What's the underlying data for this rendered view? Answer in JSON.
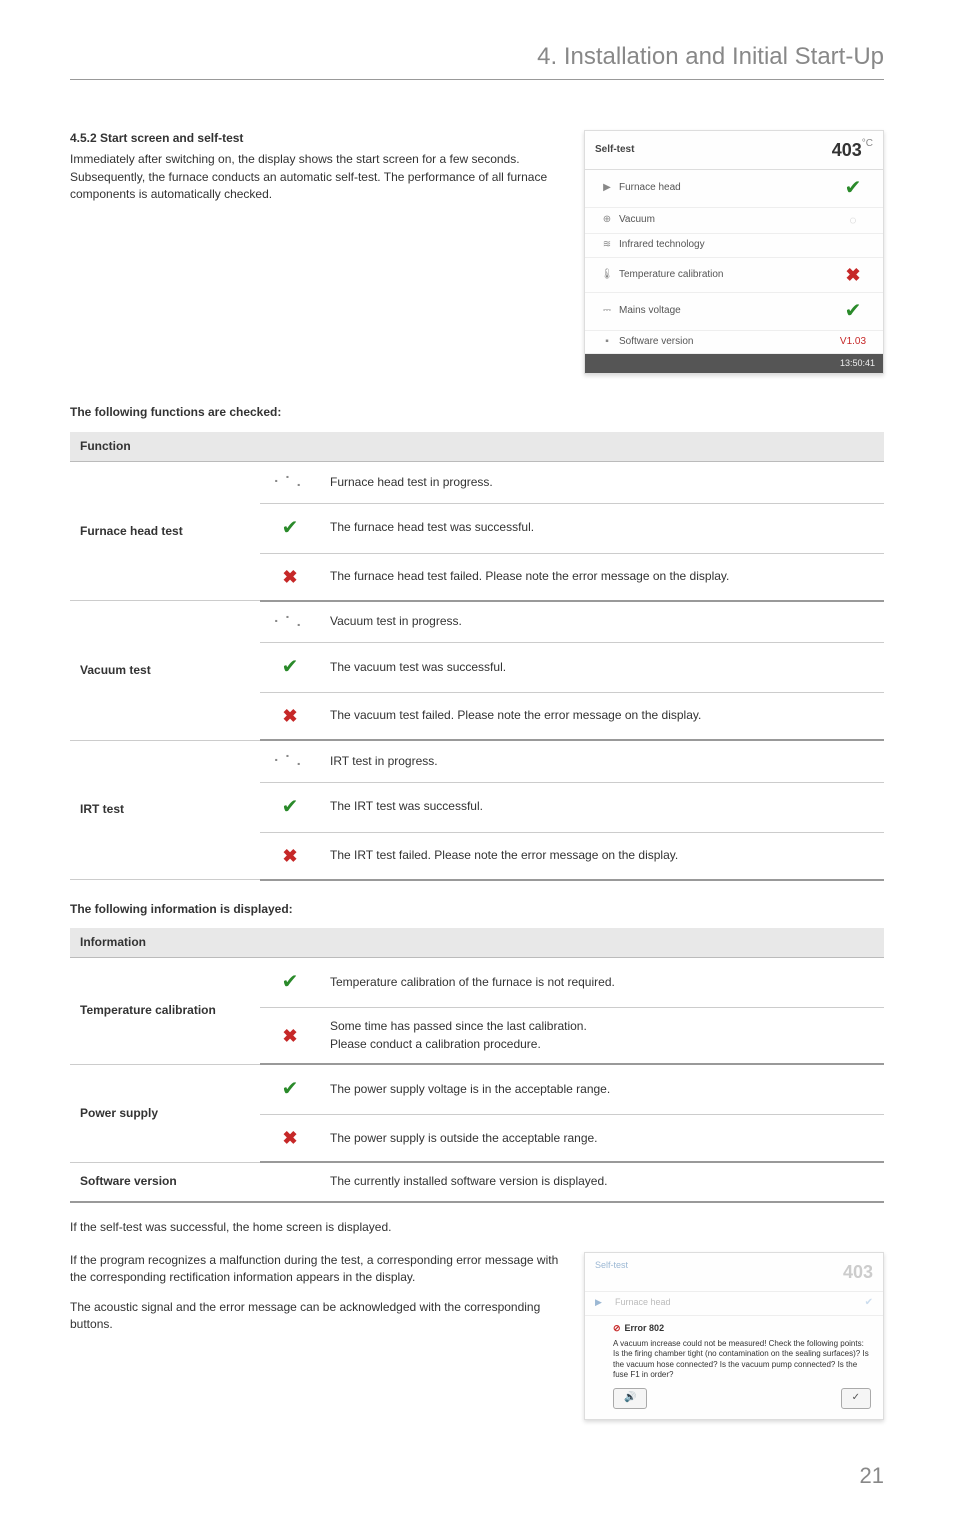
{
  "header": {
    "title": "4. Installation and Initial Start-Up"
  },
  "section": {
    "heading": "4.5.2  Start screen and self-test",
    "body": "Immediately after switching on, the display shows the start screen for a few seconds. Subsequently, the furnace conducts an automatic self-test. The performance of all furnace components is automatically checked."
  },
  "selftest_screenshot": {
    "title": "Self-test",
    "temperature": "403",
    "temperature_unit": "°C",
    "rows": [
      {
        "icon": "flame-icon",
        "icon_char": "▶",
        "label": "Furnace head",
        "status_icon": "check",
        "status_char": "✔"
      },
      {
        "icon": "gauge-icon",
        "icon_char": "⊕",
        "label": "Vacuum",
        "status_icon": "spinner",
        "status_char": "◌"
      },
      {
        "icon": "waves-icon",
        "icon_char": "≋",
        "label": "Infrared technology",
        "status_icon": "",
        "status_char": ""
      },
      {
        "icon": "thermometer-icon",
        "icon_char": "🌡",
        "label": "Temperature calibration",
        "status_icon": "x",
        "status_char": "✖"
      },
      {
        "icon": "plug-icon",
        "icon_char": "⎓",
        "label": "Mains voltage",
        "status_icon": "check",
        "status_char": "✔"
      },
      {
        "icon": "chip-icon",
        "icon_char": "▪",
        "label": "Software version",
        "status_icon": "version",
        "status_char": "V1.03"
      }
    ],
    "footer_time": "13:50:41"
  },
  "functions_heading": "The following functions are checked:",
  "functions_table": {
    "header": "Function",
    "groups": [
      {
        "label": "Furnace head test",
        "rows": [
          {
            "icon": "progress",
            "desc": "Furnace head test in progress."
          },
          {
            "icon": "check",
            "desc": "The furnace head test was successful."
          },
          {
            "icon": "x",
            "desc": "The furnace head test failed. Please note the error message on the display."
          }
        ]
      },
      {
        "label": "Vacuum test",
        "rows": [
          {
            "icon": "progress",
            "desc": "Vacuum test in progress."
          },
          {
            "icon": "check",
            "desc": "The vacuum test was successful."
          },
          {
            "icon": "x",
            "desc": "The vacuum test failed. Please note the error message on the display."
          }
        ]
      },
      {
        "label": "IRT test",
        "rows": [
          {
            "icon": "progress",
            "desc": "IRT test in progress."
          },
          {
            "icon": "check",
            "desc": "The IRT test was successful."
          },
          {
            "icon": "x",
            "desc": "The IRT test failed. Please note the error message on the display."
          }
        ]
      }
    ]
  },
  "info_heading": "The following information is displayed:",
  "info_table": {
    "header": "Information",
    "groups": [
      {
        "label": "Temperature calibration",
        "rows": [
          {
            "icon": "check",
            "desc": "Temperature calibration of the furnace is not required."
          },
          {
            "icon": "x",
            "desc": "Some time has passed since the last calibration.\nPlease conduct a calibration procedure."
          }
        ]
      },
      {
        "label": "Power supply",
        "rows": [
          {
            "icon": "check",
            "desc": "The power supply voltage is in the acceptable range."
          },
          {
            "icon": "x",
            "desc": "The power supply is outside the acceptable range."
          }
        ]
      },
      {
        "label": "Software version",
        "rows": [
          {
            "icon": "",
            "desc": "The currently installed software version is displayed."
          }
        ]
      }
    ]
  },
  "bottom": {
    "p1": "If the self-test was successful, the home screen is displayed.",
    "p2": "If the program recognizes a malfunction during the test, a corresponding error message with the corresponding rectification information appears in the display.",
    "p3": "The acoustic signal and the error message can be acknowledged with the corresponding buttons."
  },
  "error_screenshot": {
    "title": "Self-test",
    "temperature": "403",
    "row1_label": "Furnace head",
    "error_title": "Error 802",
    "error_msg": "A vacuum increase could not be measured! Check the following points: Is the firing chamber tight (no contamination on the sealing surfaces)? Is the vacuum hose connected? Is the vacuum pump connected? Is the fuse F1 in order?",
    "btn_sound": "🔊",
    "btn_ok": "✓"
  },
  "page_number": "21"
}
